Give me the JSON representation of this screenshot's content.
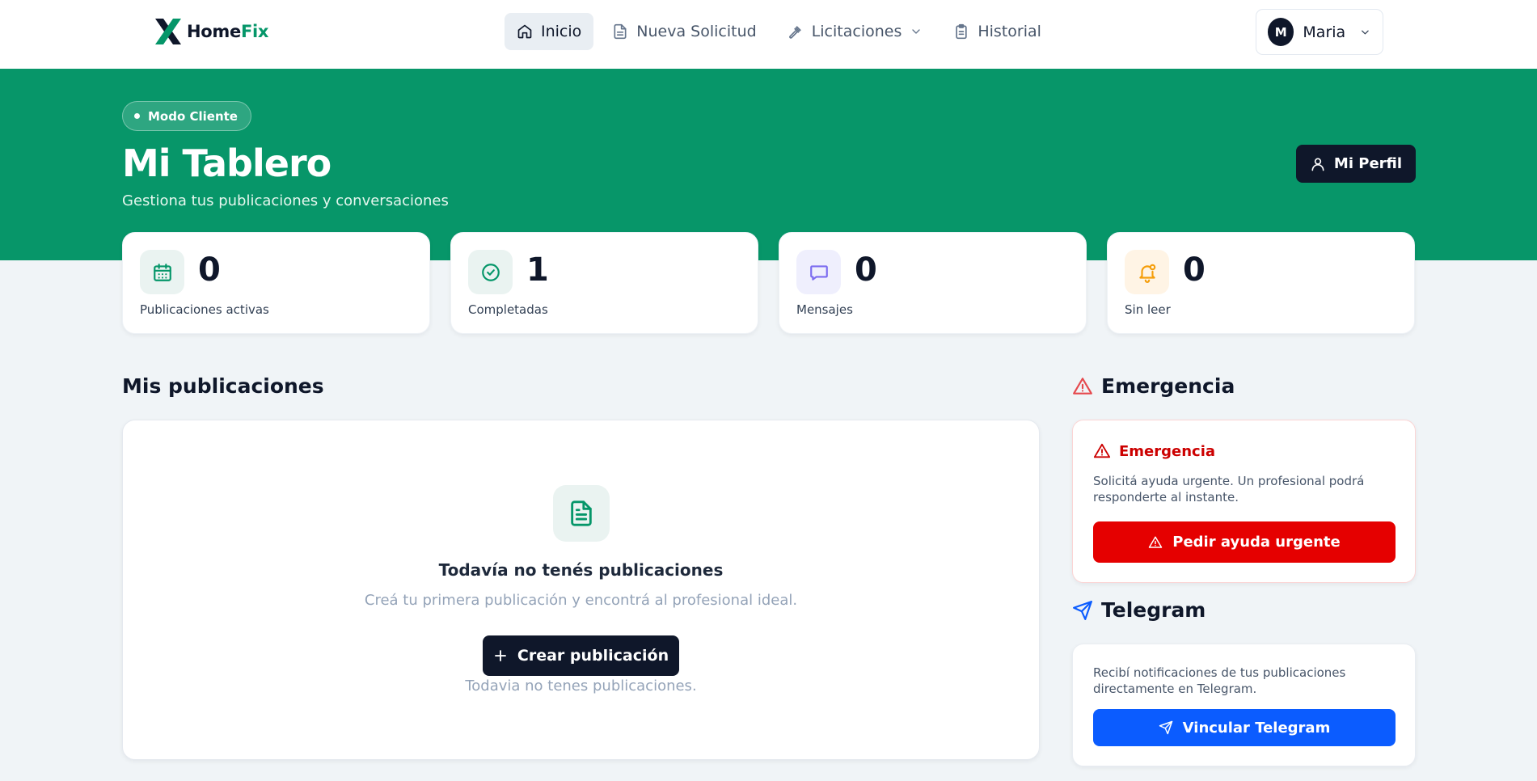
{
  "brand": {
    "name_part1": "Home",
    "name_part2": "Fix",
    "accent": "#059669"
  },
  "nav": {
    "items": [
      {
        "label": "Inicio",
        "icon": "home-icon",
        "active": true
      },
      {
        "label": "Nueva Solicitud",
        "icon": "document-icon"
      },
      {
        "label": "Licitaciones",
        "icon": "gavel-icon",
        "has_dropdown": true
      },
      {
        "label": "Historial",
        "icon": "clipboard-icon"
      }
    ]
  },
  "user": {
    "initial": "M",
    "name": "Maria"
  },
  "hero": {
    "mode_badge": "Modo Cliente",
    "title": "Mi Tablero",
    "subtitle": "Gestiona tus publicaciones y conversaciones",
    "profile_button": "Mi Perfil",
    "background": "#079669"
  },
  "stats": [
    {
      "value": "0",
      "label": "Publicaciones activas",
      "icon": "calendar-icon",
      "color": "#059669",
      "bg": "#eaf3f1"
    },
    {
      "value": "1",
      "label": "Completadas",
      "icon": "check-circle-icon",
      "color": "#059669",
      "bg": "#eaf3f1"
    },
    {
      "value": "0",
      "label": "Mensajes",
      "icon": "message-icon",
      "color": "#7c6cf0",
      "bg": "#efeffd"
    },
    {
      "value": "0",
      "label": "Sin leer",
      "icon": "bell-icon",
      "color": "#f59e0b",
      "bg": "#fff4e5"
    }
  ],
  "publications": {
    "title": "Mis publicaciones",
    "empty_title": "Todavía no tenés publicaciones",
    "empty_subtitle": "Creá tu primera publicación y encontrá al profesional ideal.",
    "create_button": "Crear publicación",
    "empty_note": "Todavia no tenes publicaciones."
  },
  "emergency": {
    "section_title": "Emergencia",
    "card_title": "Emergencia",
    "text": "Solicitá ayuda urgente. Un profesional podrá responderte al instante.",
    "button": "Pedir ayuda urgente",
    "color": "#e50000"
  },
  "telegram": {
    "section_title": "Telegram",
    "text": "Recibí notificaciones de tus publicaciones directamente en Telegram.",
    "button": "Vincular Telegram",
    "color": "#0b5cff"
  }
}
